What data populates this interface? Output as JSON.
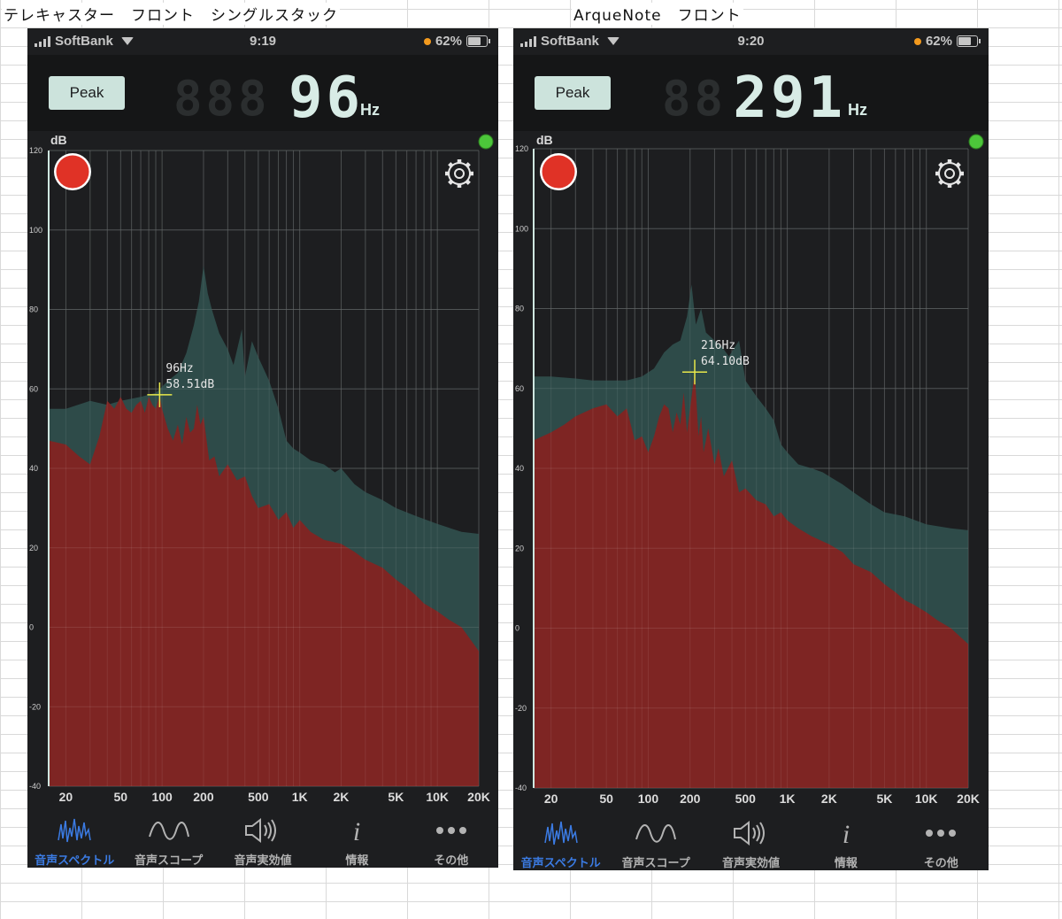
{
  "captions": {
    "left": "テレキャスター　フロント　シングルスタック",
    "right": "ArqueNote　フロント"
  },
  "phones": [
    {
      "status": {
        "carrier": "SoftBank",
        "time": "9:19",
        "battery": "62%"
      },
      "peak_label": "Peak",
      "ghost_digits": "888",
      "frequency": "96",
      "unit": "Hz",
      "db_label": "dB",
      "marker": {
        "freq_label": "96Hz",
        "db_label": "58.51dB"
      },
      "tabs": [
        {
          "label": "音声スペクトル",
          "icon": "spectrum-icon",
          "active": true
        },
        {
          "label": "音声スコープ",
          "icon": "scope-wave-icon",
          "active": false
        },
        {
          "label": "音声実効値",
          "icon": "speaker-icon",
          "active": false
        },
        {
          "label": "情報",
          "icon": "info-icon",
          "active": false
        },
        {
          "label": "その他",
          "icon": "more-dots-icon",
          "active": false
        }
      ]
    },
    {
      "status": {
        "carrier": "SoftBank",
        "time": "9:20",
        "battery": "62%"
      },
      "peak_label": "Peak",
      "ghost_digits": "88",
      "frequency": "291",
      "unit": "Hz",
      "db_label": "dB",
      "marker": {
        "freq_label": "216Hz",
        "db_label": "64.10dB"
      },
      "tabs": [
        {
          "label": "音声スペクトル",
          "icon": "spectrum-icon",
          "active": true
        },
        {
          "label": "音声スコープ",
          "icon": "scope-wave-icon",
          "active": false
        },
        {
          "label": "音声実効値",
          "icon": "speaker-icon",
          "active": false
        },
        {
          "label": "情報",
          "icon": "info-icon",
          "active": false
        },
        {
          "label": "その他",
          "icon": "more-dots-icon",
          "active": false
        }
      ]
    }
  ],
  "chart_data": [
    {
      "type": "area",
      "title": "",
      "x_scale": "log",
      "xlim": [
        15,
        20000
      ],
      "ylim": [
        -40,
        120
      ],
      "y_ticks": [
        "120",
        "100",
        "80",
        "60",
        "40",
        "20",
        "0",
        "-20",
        "-40"
      ],
      "x_ticks": [
        "20",
        "50",
        "100",
        "200",
        "500",
        "1K",
        "2K",
        "5K",
        "10K",
        "20K"
      ],
      "x_tick_values": [
        20,
        50,
        100,
        200,
        500,
        1000,
        2000,
        5000,
        10000,
        20000
      ],
      "grid": true,
      "marker": {
        "x": 96,
        "y": 58.51
      },
      "series": [
        {
          "color": "#2e4b49",
          "points": [
            [
              15,
              55
            ],
            [
              20,
              55
            ],
            [
              30,
              57
            ],
            [
              40,
              56
            ],
            [
              50,
              57
            ],
            [
              70,
              58
            ],
            [
              90,
              59
            ],
            [
              110,
              62
            ],
            [
              130,
              64
            ],
            [
              150,
              69
            ],
            [
              170,
              76
            ],
            [
              185,
              82
            ],
            [
              200,
              91
            ],
            [
              215,
              84
            ],
            [
              230,
              80
            ],
            [
              260,
              74
            ],
            [
              300,
              70
            ],
            [
              330,
              66
            ],
            [
              380,
              75
            ],
            [
              400,
              63
            ],
            [
              450,
              72
            ],
            [
              500,
              68
            ],
            [
              600,
              62
            ],
            [
              700,
              55
            ],
            [
              800,
              47
            ],
            [
              900,
              45
            ],
            [
              1000,
              44
            ],
            [
              1200,
              42
            ],
            [
              1500,
              41
            ],
            [
              1800,
              39
            ],
            [
              2000,
              40
            ],
            [
              2500,
              36
            ],
            [
              3000,
              34
            ],
            [
              4000,
              32
            ],
            [
              5000,
              30
            ],
            [
              7000,
              28
            ],
            [
              10000,
              26
            ],
            [
              15000,
              24
            ],
            [
              20000,
              23.5
            ]
          ]
        },
        {
          "color": "#7e2523",
          "points": [
            [
              15,
              47
            ],
            [
              20,
              46
            ],
            [
              25,
              43
            ],
            [
              30,
              41
            ],
            [
              35,
              48
            ],
            [
              40,
              57
            ],
            [
              45,
              55
            ],
            [
              50,
              58
            ],
            [
              55,
              55
            ],
            [
              60,
              54
            ],
            [
              65,
              56
            ],
            [
              70,
              57
            ],
            [
              75,
              54
            ],
            [
              80,
              58
            ],
            [
              85,
              56
            ],
            [
              90,
              55
            ],
            [
              96,
              58.5
            ],
            [
              100,
              55
            ],
            [
              110,
              50
            ],
            [
              120,
              47
            ],
            [
              130,
              51
            ],
            [
              140,
              46
            ],
            [
              150,
              53
            ],
            [
              160,
              49
            ],
            [
              170,
              50
            ],
            [
              180,
              56
            ],
            [
              190,
              51
            ],
            [
              200,
              53
            ],
            [
              220,
              42
            ],
            [
              240,
              43
            ],
            [
              260,
              38
            ],
            [
              300,
              41
            ],
            [
              350,
              37
            ],
            [
              400,
              38
            ],
            [
              450,
              33
            ],
            [
              500,
              30
            ],
            [
              600,
              31
            ],
            [
              700,
              27
            ],
            [
              800,
              29
            ],
            [
              900,
              25
            ],
            [
              1000,
              27
            ],
            [
              1200,
              24
            ],
            [
              1500,
              22
            ],
            [
              2000,
              21
            ],
            [
              2500,
              19
            ],
            [
              3000,
              17
            ],
            [
              4000,
              15
            ],
            [
              5000,
              12
            ],
            [
              6000,
              10
            ],
            [
              7000,
              8
            ],
            [
              8000,
              6
            ],
            [
              10000,
              4
            ],
            [
              12000,
              2
            ],
            [
              15000,
              0
            ],
            [
              20000,
              -6
            ]
          ]
        }
      ]
    },
    {
      "type": "area",
      "title": "",
      "x_scale": "log",
      "xlim": [
        15,
        20000
      ],
      "ylim": [
        -40,
        120
      ],
      "y_ticks": [
        "120",
        "100",
        "80",
        "60",
        "40",
        "20",
        "0",
        "-20",
        "-40"
      ],
      "x_ticks": [
        "20",
        "50",
        "100",
        "200",
        "500",
        "1K",
        "2K",
        "5K",
        "10K",
        "20K"
      ],
      "x_tick_values": [
        20,
        50,
        100,
        200,
        500,
        1000,
        2000,
        5000,
        10000,
        20000
      ],
      "grid": true,
      "marker": {
        "x": 216,
        "y": 64.1
      },
      "series": [
        {
          "color": "#2e4b49",
          "points": [
            [
              15,
              63
            ],
            [
              20,
              63
            ],
            [
              30,
              62.5
            ],
            [
              40,
              62
            ],
            [
              50,
              62
            ],
            [
              70,
              62
            ],
            [
              90,
              63
            ],
            [
              110,
              65
            ],
            [
              130,
              69
            ],
            [
              150,
              71
            ],
            [
              170,
              72
            ],
            [
              190,
              78
            ],
            [
              205,
              86
            ],
            [
              220,
              76
            ],
            [
              240,
              80
            ],
            [
              260,
              74
            ],
            [
              300,
              72
            ],
            [
              330,
              71
            ],
            [
              380,
              68
            ],
            [
              450,
              72
            ],
            [
              500,
              62
            ],
            [
              600,
              58
            ],
            [
              700,
              55
            ],
            [
              800,
              52
            ],
            [
              900,
              46
            ],
            [
              1000,
              44
            ],
            [
              1200,
              41
            ],
            [
              1500,
              40
            ],
            [
              1800,
              39
            ],
            [
              2000,
              38
            ],
            [
              2500,
              36
            ],
            [
              3000,
              34
            ],
            [
              4000,
              31
            ],
            [
              5000,
              29
            ],
            [
              7000,
              28
            ],
            [
              10000,
              26
            ],
            [
              15000,
              25
            ],
            [
              20000,
              24.5
            ]
          ]
        },
        {
          "color": "#7e2523",
          "points": [
            [
              15,
              47
            ],
            [
              20,
              49
            ],
            [
              25,
              51
            ],
            [
              30,
              53
            ],
            [
              40,
              55
            ],
            [
              50,
              56
            ],
            [
              60,
              53
            ],
            [
              70,
              55
            ],
            [
              80,
              47
            ],
            [
              90,
              48
            ],
            [
              100,
              44
            ],
            [
              110,
              48
            ],
            [
              120,
              53
            ],
            [
              130,
              56
            ],
            [
              140,
              55
            ],
            [
              150,
              49
            ],
            [
              160,
              54
            ],
            [
              170,
              51
            ],
            [
              180,
              59
            ],
            [
              190,
              49
            ],
            [
              200,
              55
            ],
            [
              216,
              64.1
            ],
            [
              230,
              48
            ],
            [
              240,
              53
            ],
            [
              250,
              44
            ],
            [
              270,
              50
            ],
            [
              300,
              41
            ],
            [
              320,
              45
            ],
            [
              350,
              38
            ],
            [
              400,
              42
            ],
            [
              450,
              34
            ],
            [
              500,
              35
            ],
            [
              600,
              32
            ],
            [
              700,
              31
            ],
            [
              800,
              28
            ],
            [
              900,
              29
            ],
            [
              1000,
              27
            ],
            [
              1200,
              25
            ],
            [
              1500,
              23
            ],
            [
              2000,
              21
            ],
            [
              2500,
              19
            ],
            [
              3000,
              16
            ],
            [
              4000,
              14
            ],
            [
              5000,
              11
            ],
            [
              6000,
              9
            ],
            [
              7000,
              7
            ],
            [
              8000,
              6
            ],
            [
              10000,
              4
            ],
            [
              12000,
              2
            ],
            [
              15000,
              0
            ],
            [
              20000,
              -4
            ]
          ]
        }
      ]
    }
  ]
}
